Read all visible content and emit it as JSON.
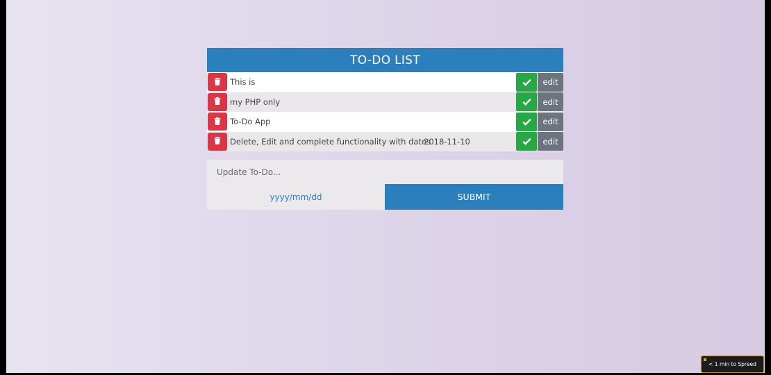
{
  "header": {
    "title": "TO-DO LIST"
  },
  "items": [
    {
      "text": "This is",
      "date": ""
    },
    {
      "text": "my PHP only",
      "date": ""
    },
    {
      "text": "To-Do App",
      "date": ""
    },
    {
      "text": "Delete, Edit and complete functionality with dates",
      "date": "2018-11-10"
    }
  ],
  "actions": {
    "edit_label": "edit"
  },
  "icons": {
    "delete": "trash-icon",
    "complete": "check-icon"
  },
  "colors": {
    "primary": "#2b7fbd",
    "delete": "#dc3545",
    "complete": "#28a745",
    "edit": "#6c757d"
  },
  "form": {
    "todo_placeholder": "Update To-Do...",
    "date_placeholder": "yyyy/mm/dd",
    "submit_label": "SUBMIT"
  },
  "toast": {
    "text": "< 1 min to Spreed"
  }
}
